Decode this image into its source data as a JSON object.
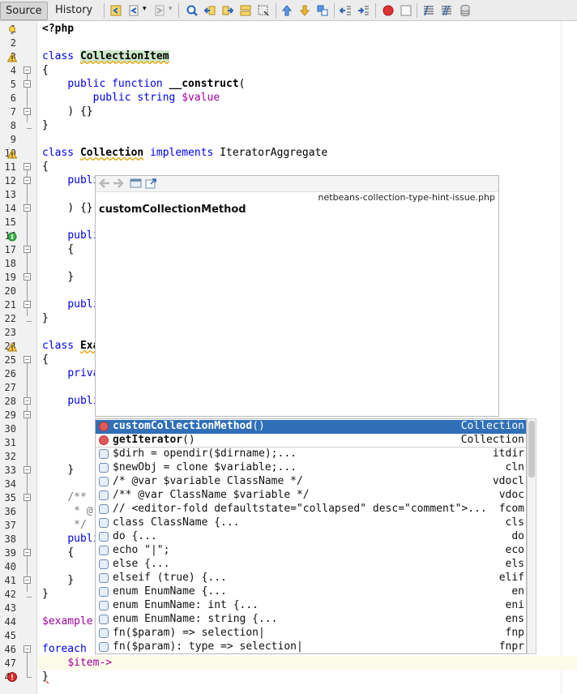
{
  "tabs": [
    {
      "label": "Source",
      "active": true
    },
    {
      "label": "History",
      "active": false
    }
  ],
  "toolbar_icons": [
    "last-edit-icon",
    "back-icon",
    "forward-icon",
    "find-icon",
    "find-previous-icon",
    "find-next-icon",
    "find-selection-icon",
    "toggle-highlight-icon",
    "previous-bookmark-icon",
    "next-bookmark-icon",
    "toggle-bookmark-icon",
    "shift-left-icon",
    "shift-right-icon",
    "record-macro-icon",
    "stop-macro-icon",
    "comment-icon",
    "uncomment-icon",
    "database-icon"
  ],
  "line_numbers": [
    "1",
    "2",
    "3",
    "4",
    "5",
    "6",
    "7",
    "8",
    "9",
    "10",
    "11",
    "12",
    "13",
    "14",
    "15",
    "16",
    "17",
    "18",
    "19",
    "20",
    "21",
    "22",
    "23",
    "24",
    "25",
    "26",
    "27",
    "28",
    "29",
    "30",
    "31",
    "32",
    "33",
    "34",
    "35",
    "36",
    "37",
    "38",
    "39",
    "40",
    "41",
    "42",
    "43",
    "44",
    "45",
    "46",
    "47",
    "48"
  ],
  "code": {
    "l1": "<?php",
    "l3_kw": "class ",
    "l3_name": "CollectionItem",
    "l4": "{",
    "l5_kw1": "public ",
    "l5_kw2": "function ",
    "l5_fn": "__construct",
    "l5_rest": "(",
    "l6_kw": "public string ",
    "l6_var": "$value",
    "l7": ") {}",
    "l8": "}",
    "l10_kw": "class ",
    "l10_name": "Collection",
    "l10_kw2": " implements ",
    "l10_iface": "IteratorAggregate",
    "l11": "{",
    "l12": "publi",
    "l14": ") {}",
    "l16": "publi",
    "l17": "{",
    "l19": "}",
    "l21": "publi",
    "l22": "}",
    "l24_kw": "class ",
    "l24_name": "Exa",
    "l25": "{",
    "l26": "priva",
    "l28": "publi",
    "l33": "}",
    "l35": "/**",
    "l36": "* @",
    "l37": "*/",
    "l38": "publi",
    "l39": "{",
    "l41": "}",
    "l42": "}",
    "l44": "$example",
    "l46": "foreach",
    "l47": "$item->",
    "l48": "}"
  },
  "doc_popup": {
    "file": "netbeans-collection-type-hint-issue.php",
    "title": "customCollectionMethod"
  },
  "completion": [
    {
      "name": "customCollectionMethod",
      "args": "()",
      "abbr": "Collection",
      "kind": "method",
      "selected": true
    },
    {
      "name": "getIterator",
      "args": "()",
      "abbr": "Collection",
      "kind": "method",
      "selected": false
    },
    {
      "text": "$dirh = opendir($dirname);...",
      "abbr": "itdir",
      "kind": "template"
    },
    {
      "text": "$newObj = clone $variable;...",
      "abbr": "cln",
      "kind": "template"
    },
    {
      "text": "/* @var $variable ClassName */",
      "abbr": "vdocl",
      "kind": "template"
    },
    {
      "text": "/** @var ClassName $variable */",
      "abbr": "vdoc",
      "kind": "template"
    },
    {
      "text": "// <editor-fold defaultstate=\"collapsed\" desc=\"comment\">...",
      "abbr": "fcom",
      "kind": "template"
    },
    {
      "text": "class ClassName {...",
      "abbr": "cls",
      "kind": "template"
    },
    {
      "text": "do {...",
      "abbr": "do",
      "kind": "template"
    },
    {
      "text": "echo \"|\";",
      "abbr": "eco",
      "kind": "template"
    },
    {
      "text": "else {...",
      "abbr": "els",
      "kind": "template"
    },
    {
      "text": "elseif (true) {...",
      "abbr": "elif",
      "kind": "template"
    },
    {
      "text": "enum EnumName {...",
      "abbr": "en",
      "kind": "template"
    },
    {
      "text": "enum EnumName: int {...",
      "abbr": "eni",
      "kind": "template"
    },
    {
      "text": "enum EnumName: string {...",
      "abbr": "ens",
      "kind": "template"
    },
    {
      "text": "fn($param) => selection|",
      "abbr": "fnp",
      "kind": "template"
    },
    {
      "text": "fn($param): type => selection|",
      "abbr": "fnpr",
      "kind": "template"
    }
  ],
  "colors": {
    "selection": "#2f6fb7",
    "keyword": "#0000e6",
    "variable": "#a000a0",
    "highlight": "#cde8c9"
  }
}
